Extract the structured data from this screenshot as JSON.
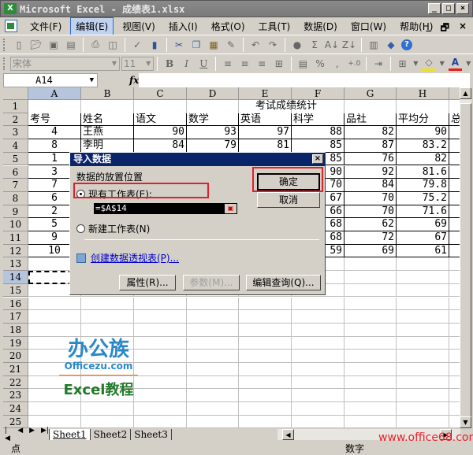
{
  "window": {
    "app_icon": "X",
    "title": "Microsoft Excel - 成绩表1.xlsx",
    "controls": [
      "_",
      "□",
      "×"
    ]
  },
  "menubar": {
    "items": [
      {
        "label": "文件(F)"
      },
      {
        "label": "编辑(E)",
        "active": true
      },
      {
        "label": "视图(V)"
      },
      {
        "label": "插入(I)"
      },
      {
        "label": "格式(O)"
      },
      {
        "label": "工具(T)"
      },
      {
        "label": "数据(D)"
      },
      {
        "label": "窗口(W)"
      },
      {
        "label": "帮助(H)"
      }
    ],
    "doc_controls": [
      "_",
      "🗗",
      "×"
    ]
  },
  "toolbar_standard": {
    "icons": [
      "new-icon",
      "open-icon",
      "save-icon",
      "permission-icon",
      "print-icon",
      "print-preview-icon",
      "spelling-icon",
      "research-icon",
      "cut-icon",
      "copy-icon",
      "paste-icon",
      "format-painter-icon",
      "undo-icon",
      "redo-icon",
      "hyperlink-icon",
      "autosum-icon",
      "sort-asc-icon",
      "sort-desc-icon",
      "chart-wizard-icon",
      "drawing-icon",
      "help-icon"
    ],
    "glyphs": {
      "autosum": "Σ",
      "sort_asc": "A↓",
      "sort_desc": "Z↓",
      "help": "?"
    }
  },
  "toolbar_formatting": {
    "font_name": "宋体",
    "font_size": "11",
    "bold": "B",
    "italic": "I",
    "underline": "U",
    "percent": "%",
    "comma": ",",
    "decimal": "+.0",
    "fill_color": "#f0e020",
    "font_color": "#e02020",
    "font_color_glyph": "A"
  },
  "formula_bar": {
    "name_box": "A14",
    "fx": "fx",
    "value": ""
  },
  "sheet": {
    "columns": [
      "A",
      "B",
      "C",
      "D",
      "E",
      "F",
      "G",
      "H"
    ],
    "selected_column": "A",
    "selected_row": 14,
    "row_count": 25,
    "title": "考试成绩统计",
    "headers": [
      "考号",
      "姓名",
      "语文",
      "数学",
      "英语",
      "科学",
      "品社",
      "平均分",
      "总"
    ],
    "rows": [
      [
        "4",
        "王燕",
        "90",
        "93",
        "97",
        "88",
        "82",
        "90"
      ],
      [
        "8",
        "李明",
        "84",
        "79",
        "81",
        "85",
        "87",
        "83.2"
      ],
      [
        "1",
        "",
        "",
        "",
        "",
        "85",
        "76",
        "82"
      ],
      [
        "3",
        "",
        "",
        "",
        "",
        "90",
        "92",
        "81.6"
      ],
      [
        "7",
        "",
        "",
        "",
        "",
        "70",
        "84",
        "79.8"
      ],
      [
        "6",
        "",
        "",
        "",
        "",
        "67",
        "70",
        "75.2"
      ],
      [
        "2",
        "",
        "",
        "",
        "",
        "66",
        "70",
        "71.6"
      ],
      [
        "5",
        "",
        "",
        "",
        "",
        "68",
        "62",
        "69"
      ],
      [
        "9",
        "",
        "",
        "",
        "",
        "68",
        "72",
        "67"
      ],
      [
        "10",
        "",
        "",
        "",
        "",
        "59",
        "69",
        "61"
      ]
    ]
  },
  "dialog": {
    "title": "导入数据",
    "close": "×",
    "section_label": "数据的放置位置",
    "option_existing": "现有工作表(E):",
    "option_existing_selected": true,
    "reference": "=$A$14",
    "option_new": "新建工作表(N)",
    "pivot_link": "创建数据透视表(P)...",
    "ok": "确定",
    "cancel": "取消",
    "properties": "属性(R)...",
    "parameters": "参数(M)...",
    "edit_query": "编辑查询(Q)...",
    "highlight_color": "#e0202a"
  },
  "watermark_logo": {
    "brand": "办公族",
    "site": "Officezu.com",
    "subtitle": "Excel教程"
  },
  "sheet_tabs": {
    "nav": [
      "|◀",
      "◀",
      "▶",
      "▶|"
    ],
    "tabs": [
      {
        "label": "Sheet1",
        "active": true
      },
      {
        "label": "Sheet2"
      },
      {
        "label": "Sheet3"
      }
    ]
  },
  "statusbar": {
    "mode": "点",
    "num_indicator": "数字"
  },
  "watermark_url": "www.office68.com"
}
